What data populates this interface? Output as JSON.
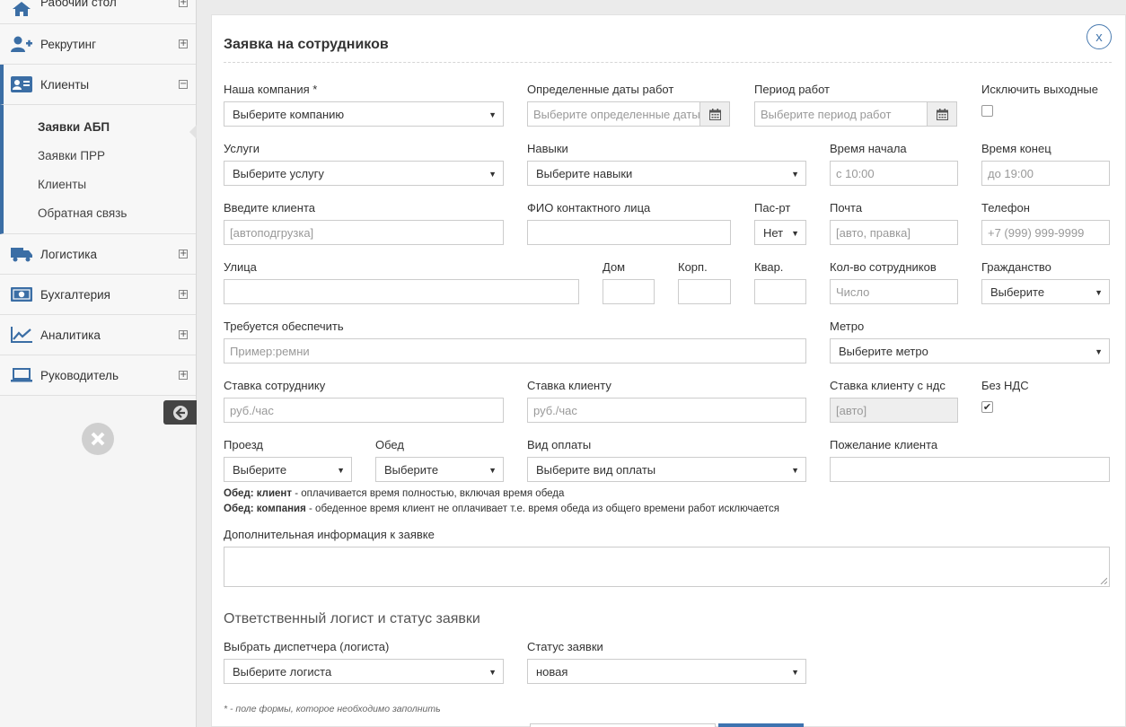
{
  "sidebar": {
    "items": [
      {
        "label": "Рабочий стол",
        "icon": "home-icon",
        "toggle": "⊞"
      },
      {
        "label": "Рекрутинг",
        "icon": "user-add-icon",
        "toggle": "⊞"
      },
      {
        "label": "Клиенты",
        "icon": "contact-card-icon",
        "toggle": "⊟"
      },
      {
        "label": "Логистика",
        "icon": "truck-icon",
        "toggle": "⊞"
      },
      {
        "label": "Бухгалтерия",
        "icon": "money-icon",
        "toggle": "⊞"
      },
      {
        "label": "Аналитика",
        "icon": "line-chart-icon",
        "toggle": "⊞"
      },
      {
        "label": "Руководитель",
        "icon": "laptop-icon",
        "toggle": "⊞"
      }
    ],
    "submenu": [
      "Заявки АБП",
      "Заявки ПРР",
      "Клиенты",
      "Обратная связь"
    ],
    "accent_color": "#3b6ea5"
  },
  "form": {
    "title": "Заявка на сотрудников",
    "close_label": "x",
    "company": {
      "label": "Наша компания *",
      "value": "Выберите компанию"
    },
    "dates": {
      "label": "Определенные даты работ",
      "placeholder": "Выберите определенные даты"
    },
    "period": {
      "label": "Период работ",
      "placeholder": "Выберите период работ"
    },
    "exclude_weekends": {
      "label": "Исключить выходные",
      "checked": false
    },
    "service": {
      "label": "Услуги",
      "value": "Выберите услугу"
    },
    "skills": {
      "label": "Навыки",
      "value": "Выберите навыки"
    },
    "time_start": {
      "label": "Время начала",
      "placeholder": "с 10:00"
    },
    "time_end": {
      "label": "Время конец",
      "placeholder": "до 19:00"
    },
    "client": {
      "label": "Введите клиента",
      "placeholder": "[автоподгрузка]"
    },
    "contact": {
      "label": "ФИО контактного лица",
      "placeholder": ""
    },
    "passport": {
      "label": "Пас-рт",
      "value": "Нет"
    },
    "email": {
      "label": "Почта",
      "placeholder": "[авто, правка]"
    },
    "phone": {
      "label": "Телефон",
      "placeholder": "+7 (999) 999-9999"
    },
    "street": {
      "label": "Улица"
    },
    "house": {
      "label": "Дом"
    },
    "building": {
      "label": "Корп."
    },
    "apartment": {
      "label": "Квар."
    },
    "employee_count": {
      "label": "Кол-во сотрудников",
      "placeholder": "Число"
    },
    "citizenship": {
      "label": "Гражданство",
      "value": "Выберите"
    },
    "provide": {
      "label": "Требуется обеспечить",
      "placeholder": "Пример:ремни"
    },
    "metro": {
      "label": "Метро",
      "value": "Выберите метро"
    },
    "employee_rate": {
      "label": "Ставка сотруднику",
      "placeholder": "руб./час"
    },
    "client_rate": {
      "label": "Ставка клиенту",
      "placeholder": "руб./час"
    },
    "client_rate_vat": {
      "label": "Ставка клиенту с ндс",
      "placeholder": "[авто]"
    },
    "no_vat": {
      "label": "Без НДС",
      "checked": true
    },
    "travel": {
      "label": "Проезд",
      "value": "Выберите"
    },
    "lunch": {
      "label": "Обед",
      "value": "Выберите"
    },
    "payment_type": {
      "label": "Вид оплаты",
      "value": "Выберите вид оплаты"
    },
    "client_wish": {
      "label": "Пожелание клиента"
    },
    "note1": {
      "bold": "Обед: клиент",
      "text": " - оплачивается время полностью, включая время обеда"
    },
    "note2": {
      "bold": "Обед: компания",
      "text": " - обеденное время клиент не оплачивает т.е. время обеда из общего времени работ исключается"
    },
    "additional": {
      "label": "Дополнительная информация к заявке"
    },
    "section2_title": "Ответственный логист и статус заявки",
    "dispatcher": {
      "label": "Выбрать диспетчера (логиста)",
      "value": "Выберите логиста"
    },
    "status": {
      "label": "Статус заявки",
      "value": "новая"
    },
    "footnote": "* - поле формы, которое необходимо заполнить",
    "primary_color": "#3e73b0"
  }
}
